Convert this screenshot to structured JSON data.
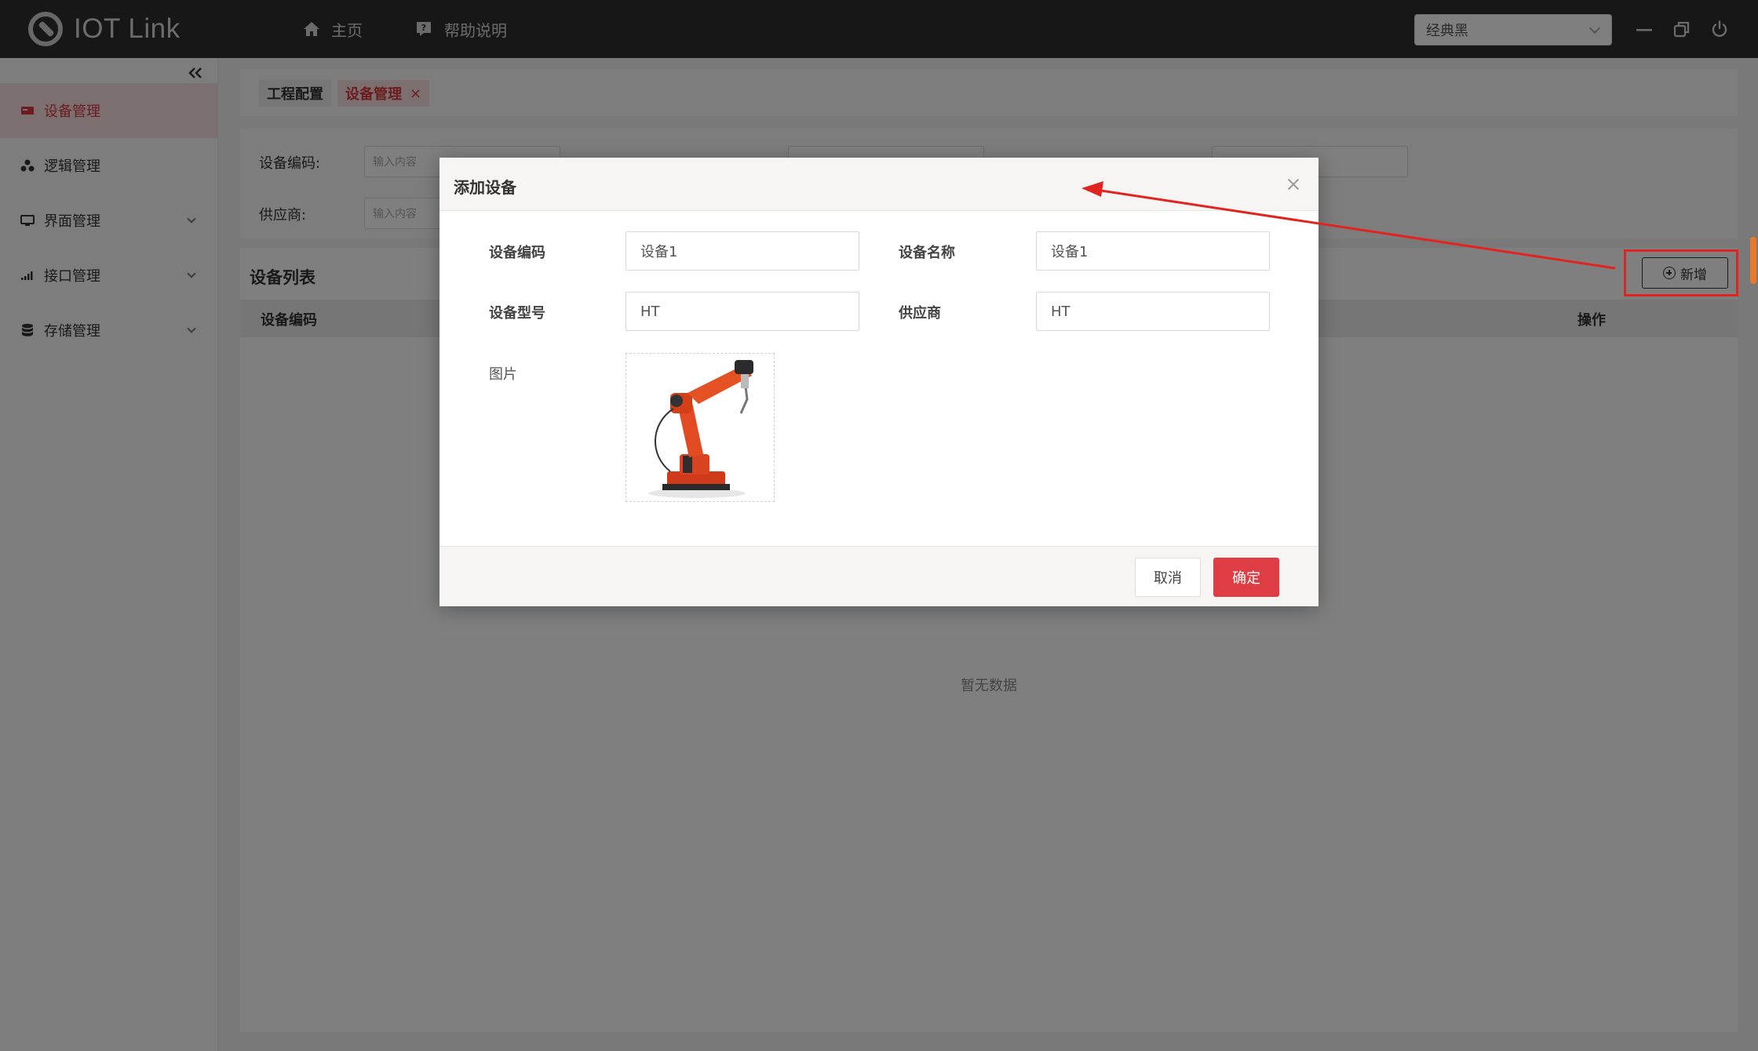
{
  "app": {
    "title": "IOT Link"
  },
  "nav": {
    "home": "主页",
    "help": "帮助说明"
  },
  "theme": {
    "selected": "经典黑"
  },
  "sidebar": {
    "items": [
      {
        "label": "设备管理",
        "active": true,
        "has_arrow": false
      },
      {
        "label": "逻辑管理",
        "active": false,
        "has_arrow": false
      },
      {
        "label": "界面管理",
        "active": false,
        "has_arrow": true
      },
      {
        "label": "接口管理",
        "active": false,
        "has_arrow": true
      },
      {
        "label": "存储管理",
        "active": false,
        "has_arrow": true
      }
    ]
  },
  "tabs": [
    {
      "label": "工程配置"
    },
    {
      "label": "设备管理",
      "close": "×"
    }
  ],
  "filters": {
    "code_label": "设备编码:",
    "code_placeholder": "输入内容",
    "supplier_label": "供应商:",
    "supplier_placeholder": "输入内容"
  },
  "list": {
    "title": "设备列表",
    "add_button": "新增",
    "columns": {
      "code": "设备编码",
      "actions": "操作"
    },
    "empty": "暂无数据"
  },
  "dialog": {
    "title": "添加设备",
    "fields": {
      "code_label": "设备编码",
      "code_value": "设备1",
      "name_label": "设备名称",
      "name_value": "设备1",
      "model_label": "设备型号",
      "model_value": "HT",
      "supplier_label": "供应商",
      "supplier_value": "HT",
      "image_label": "图片"
    },
    "cancel": "取消",
    "confirm": "确定"
  },
  "colors": {
    "topbar": "#2f2f2f",
    "accent": "#dd3d43",
    "annotation": "#e3231f"
  }
}
